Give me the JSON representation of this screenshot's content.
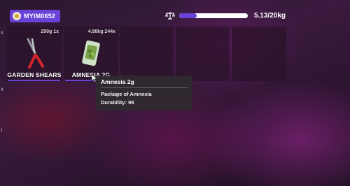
{
  "player": {
    "badge_label": "MYIM0652",
    "icon": "coin-icon"
  },
  "weight": {
    "icon": "scale-icon",
    "text": "5.13/20kg",
    "fill_fraction": 0.2565,
    "accent_color": "#6a42d8"
  },
  "left_edge_marks": [
    "x",
    "x",
    "/"
  ],
  "inventory": {
    "slots": [
      {
        "meta": "250g 1x",
        "name": "GARDEN SHEARS",
        "image": "garden-shears-image"
      },
      {
        "meta": "4.88kg 244x",
        "name": "AMNESIA 2G",
        "image": "amnesia-package-image"
      },
      {
        "meta": "",
        "name": "",
        "image": ""
      },
      {
        "meta": "",
        "name": "",
        "image": ""
      },
      {
        "meta": "",
        "name": "",
        "image": ""
      }
    ]
  },
  "tooltip": {
    "title": "Amnesia 2g",
    "description": "Package of Amnesia",
    "durability": "Durability: 98"
  }
}
